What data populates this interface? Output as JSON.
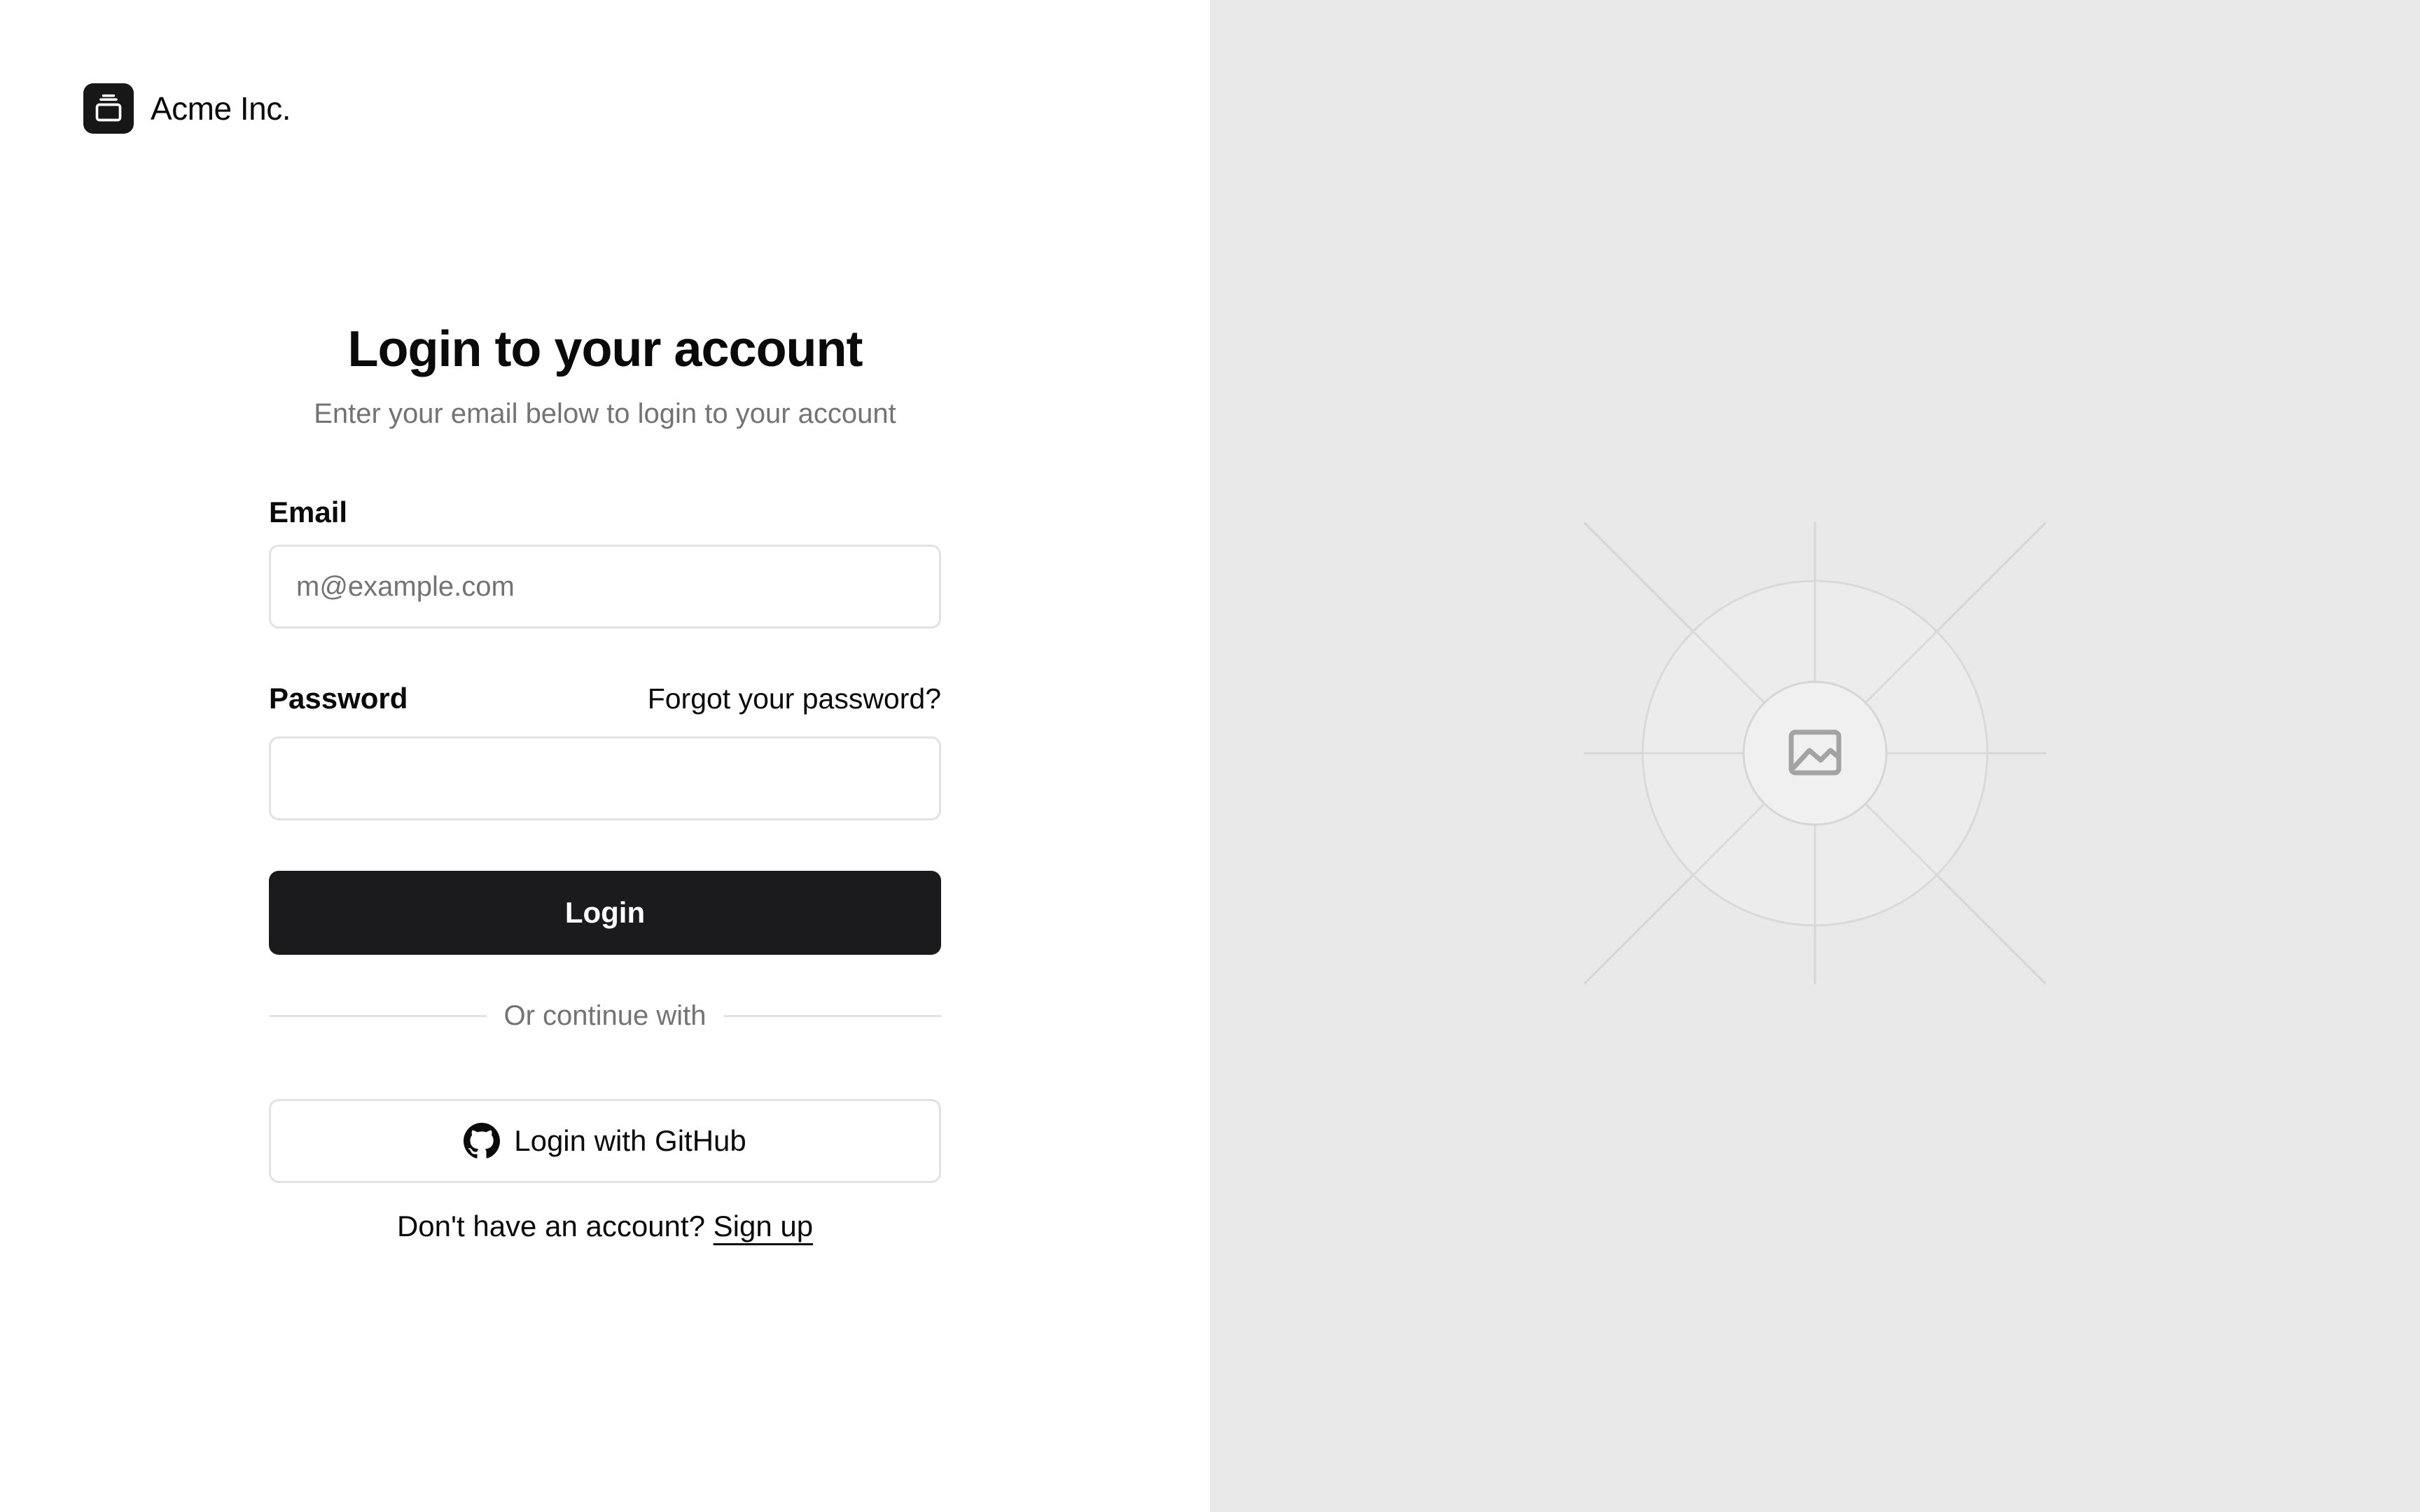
{
  "brand": {
    "name": "Acme Inc.",
    "icon": "gallery-stack-icon"
  },
  "form": {
    "title": "Login to your account",
    "subtitle": "Enter your email below to login to your account",
    "email": {
      "label": "Email",
      "placeholder": "m@example.com",
      "value": ""
    },
    "password": {
      "label": "Password",
      "forgot_label": "Forgot your password?",
      "value": ""
    },
    "login_button": "Login",
    "divider_text": "Or continue with",
    "github_button": "Login with GitHub",
    "github_icon": "github-icon",
    "signup_prompt": "Don't have an account?",
    "signup_link": "Sign up"
  },
  "side_panel": {
    "icon": "image-placeholder-icon"
  },
  "colors": {
    "primary": "#1b1b1d",
    "muted_text": "#737373",
    "border": "#e2e2e2",
    "panel_bg": "#e9e9e9"
  }
}
